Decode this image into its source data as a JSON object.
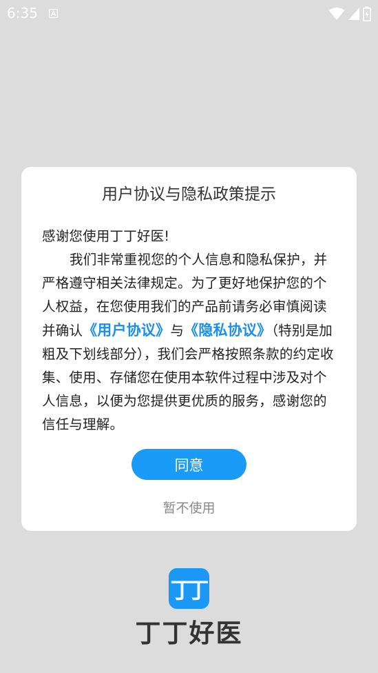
{
  "status_bar": {
    "time": "6:35"
  },
  "dialog": {
    "title": "用户协议与隐私政策提示",
    "greeting": "感谢您使用丁丁好医!",
    "body_before_links": "我们非常重视您的个人信息和隐私保护，并严格遵守相关法律规定。为了更好地保护您的个人权益，在您使用我们的产品前请务必审慎阅读并确认",
    "user_agreement_link": "《用户协议》",
    "conjunction": "与",
    "privacy_agreement_link": "《隐私协议》",
    "body_after_links": "（特别是加粗及下划线部分），我们会严格按照条款的约定收集、使用、存储您在使用本软件过程中涉及对个人信息，以便为您提供更优质的服务，感谢您的信任与理解。",
    "agree_label": "同意",
    "decline_label": "暂不使用"
  },
  "splash": {
    "logo_text": "丁丁",
    "app_name": "丁丁好医"
  },
  "colors": {
    "accent": "#1a9bf8",
    "link": "#1a8fef",
    "background": "#dcdcdc"
  },
  "icons": {
    "notification": "a-letter-notification-icon",
    "wifi": "wifi-icon",
    "signal": "signal-icon",
    "battery": "battery-icon"
  }
}
